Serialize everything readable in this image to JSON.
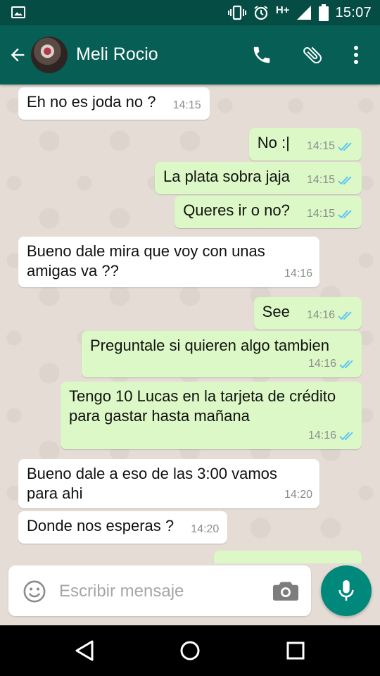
{
  "status_bar": {
    "time": "15:07",
    "network": "H+",
    "icons": [
      "image-notification-icon",
      "vibrate-icon",
      "alarm-icon",
      "signal-icon",
      "battery-icon"
    ]
  },
  "header": {
    "contact_name": "Meli Rocio",
    "icons": [
      "back-arrow-icon",
      "avatar",
      "phone-icon",
      "attach-icon",
      "more-vert-icon"
    ]
  },
  "messages": [
    {
      "direction": "in",
      "text": "Eh no es joda no ?",
      "time": "14:15"
    },
    {
      "direction": "out",
      "text": "No :|",
      "time": "14:15",
      "status": "read"
    },
    {
      "direction": "out",
      "text": "La plata sobra jaja",
      "time": "14:15",
      "status": "read"
    },
    {
      "direction": "out",
      "text": "Queres ir o no?",
      "time": "14:15",
      "status": "read"
    },
    {
      "direction": "in",
      "text": "Bueno dale mira que voy con unas amigas va ??",
      "time": "14:16"
    },
    {
      "direction": "out",
      "text": "See",
      "time": "14:16",
      "status": "read"
    },
    {
      "direction": "out",
      "text": "Preguntale si quieren algo tambien",
      "time": "14:16",
      "status": "read"
    },
    {
      "direction": "out",
      "text": "Tengo 10 Lucas en la tarjeta de crédito para gastar hasta mañana",
      "time": "14:16",
      "status": "read"
    },
    {
      "direction": "in",
      "text": "Bueno dale a eso de las 3:00 vamos para ahi",
      "time": "14:20"
    },
    {
      "direction": "in",
      "text": "Donde nos esperas ?",
      "time": "14:20"
    }
  ],
  "composer": {
    "placeholder": "Escribir mensaje"
  },
  "colors": {
    "status_bar": "#054d44",
    "app_bar": "#075e54",
    "chat_bg": "#e5ddd5",
    "outgoing_bubble": "#dcf8c6",
    "incoming_bubble": "#ffffff",
    "read_ticks": "#4fc3f7",
    "mic_fab": "#00897b"
  }
}
